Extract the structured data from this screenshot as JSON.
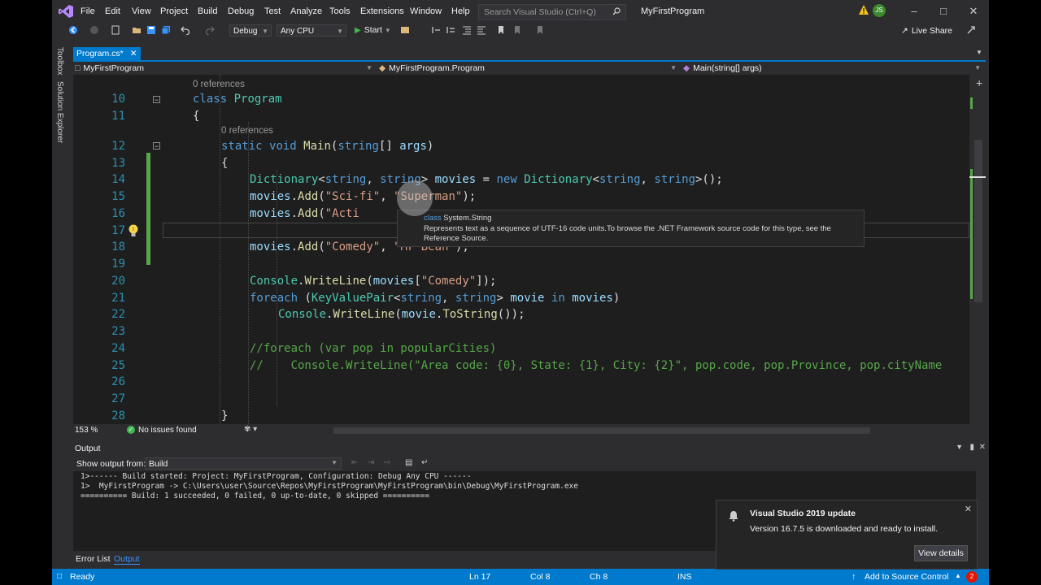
{
  "menu": [
    "File",
    "Edit",
    "View",
    "Project",
    "Build",
    "Debug",
    "Test",
    "Analyze",
    "Tools",
    "Extensions",
    "Window",
    "Help"
  ],
  "search": {
    "placeholder": "Search Visual Studio (Ctrl+Q)"
  },
  "app_title": "MyFirstProgram",
  "user_initials": "JS",
  "toolbar": {
    "config": "Debug",
    "platform": "Any CPU",
    "start": "Start",
    "live_share": "Live Share"
  },
  "side_tabs": [
    "Toolbox",
    "Solution Explorer"
  ],
  "doc_tab": {
    "label": "Program.cs*"
  },
  "navbar": {
    "project": "MyFirstProgram",
    "type": "MyFirstProgram.Program",
    "member": "Main(string[] args)"
  },
  "editor": {
    "line_numbers": [
      "10",
      "11",
      "12",
      "13",
      "14",
      "15",
      "16",
      "17",
      "18",
      "19",
      "20",
      "21",
      "22",
      "23",
      "24",
      "25",
      "26",
      "27",
      "28"
    ],
    "refs_class": "0 references",
    "refs_main": "0 references",
    "tooltip": {
      "kind": "class",
      "type": "System.String",
      "description": "Represents text as a sequence of UTF-16 code units.To browse the .NET Framework source code for this type, see the Reference Source."
    }
  },
  "editor_status": {
    "zoom": "153 %",
    "issues": "No issues found"
  },
  "output": {
    "title": "Output",
    "show_from_label": "Show output from:",
    "source": "Build",
    "lines": [
      "1>------ Build started: Project: MyFirstProgram, Configuration: Debug Any CPU ------",
      "1>  MyFirstProgram -> C:\\Users\\user\\Source\\Repos\\MyFirstProgram\\MyFirstProgram\\bin\\Debug\\MyFirstProgram.exe",
      "========== Build: 1 succeeded, 0 failed, 0 up-to-date, 0 skipped =========="
    ]
  },
  "bottom_tabs": [
    "Error List",
    "Output"
  ],
  "notification": {
    "title": "Visual Studio 2019 update",
    "body": "Version 16.7.5 is downloaded and ready to install.",
    "button": "View details"
  },
  "statusbar": {
    "ready": "Ready",
    "ln": "Ln 17",
    "col": "Col 8",
    "ch": "Ch 8",
    "ins": "INS",
    "source_control": "Add to Source Control",
    "badge": "2"
  },
  "colors": {
    "accent": "#007acc",
    "editor_bg": "#1e1e1e",
    "chrome_bg": "#2d2d30"
  }
}
